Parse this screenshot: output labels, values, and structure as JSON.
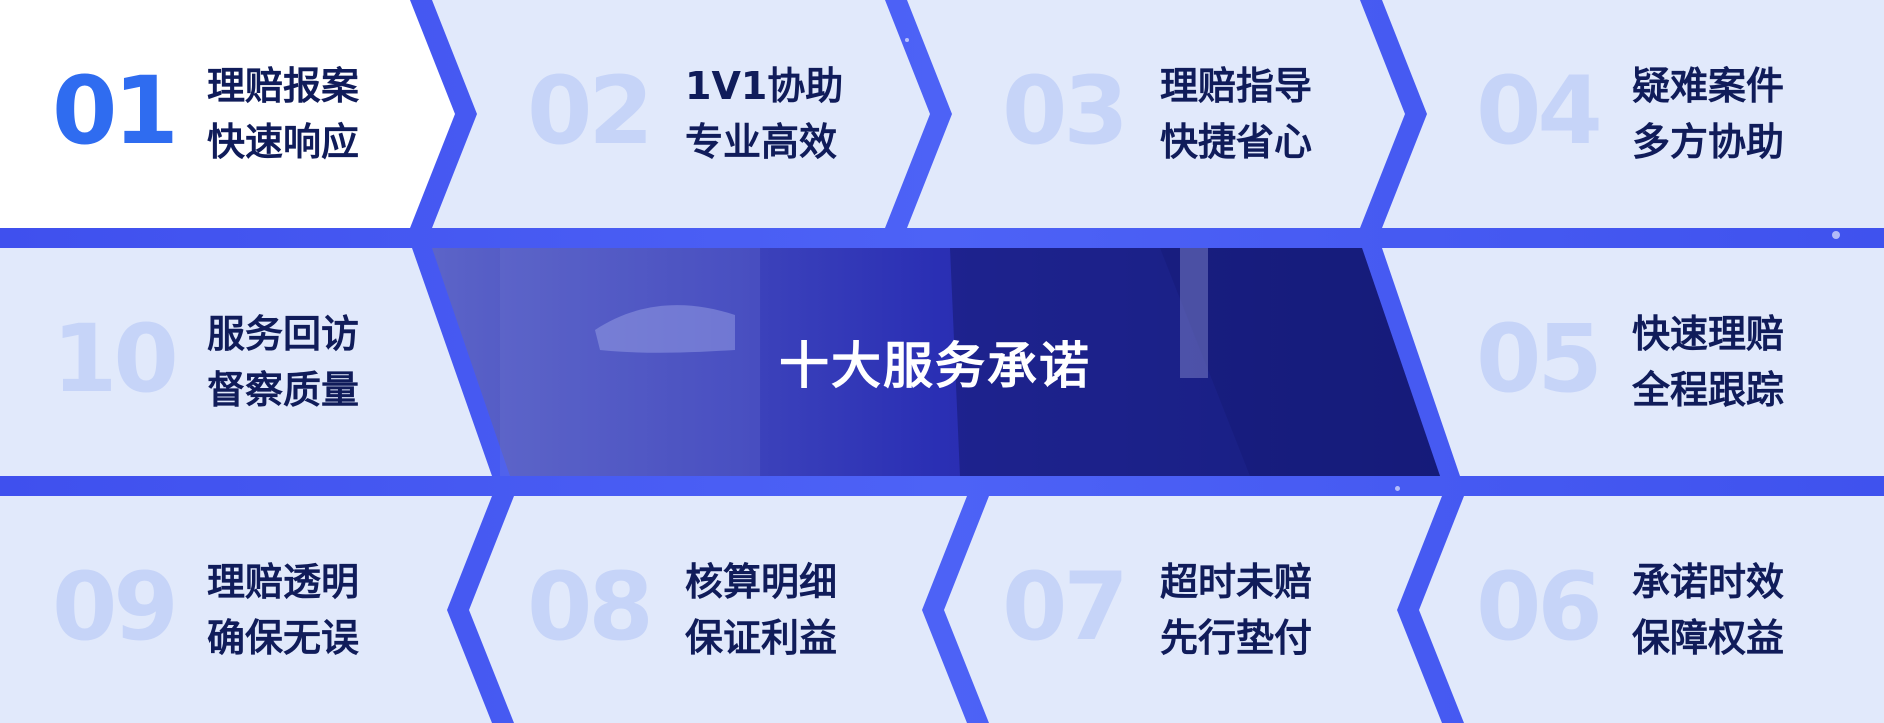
{
  "center_title": "十大服务承诺",
  "colors": {
    "frame": "#4a5cf0",
    "panel": "#e1e9fb",
    "active_panel": "#ffffff",
    "number_faint": "#c6d4f8",
    "number_active": "#2f6cf0",
    "text": "#101c5a",
    "center_bg": "#2228b0"
  },
  "promises": [
    {
      "num": "01",
      "line1": "理赔报案",
      "line2": "快速响应",
      "active": true
    },
    {
      "num": "02",
      "line1": "1V1协助",
      "line2": "专业高效"
    },
    {
      "num": "03",
      "line1": "理赔指导",
      "line2": "快捷省心"
    },
    {
      "num": "04",
      "line1": "疑难案件",
      "line2": "多方协助"
    },
    {
      "num": "05",
      "line1": "快速理赔",
      "line2": "全程跟踪"
    },
    {
      "num": "06",
      "line1": "承诺时效",
      "line2": "保障权益"
    },
    {
      "num": "07",
      "line1": "超时未赔",
      "line2": "先行垫付"
    },
    {
      "num": "08",
      "line1": "核算明细",
      "line2": "保证利益"
    },
    {
      "num": "09",
      "line1": "理赔透明",
      "line2": "确保无误"
    },
    {
      "num": "10",
      "line1": "服务回访",
      "line2": "督察质量"
    }
  ]
}
